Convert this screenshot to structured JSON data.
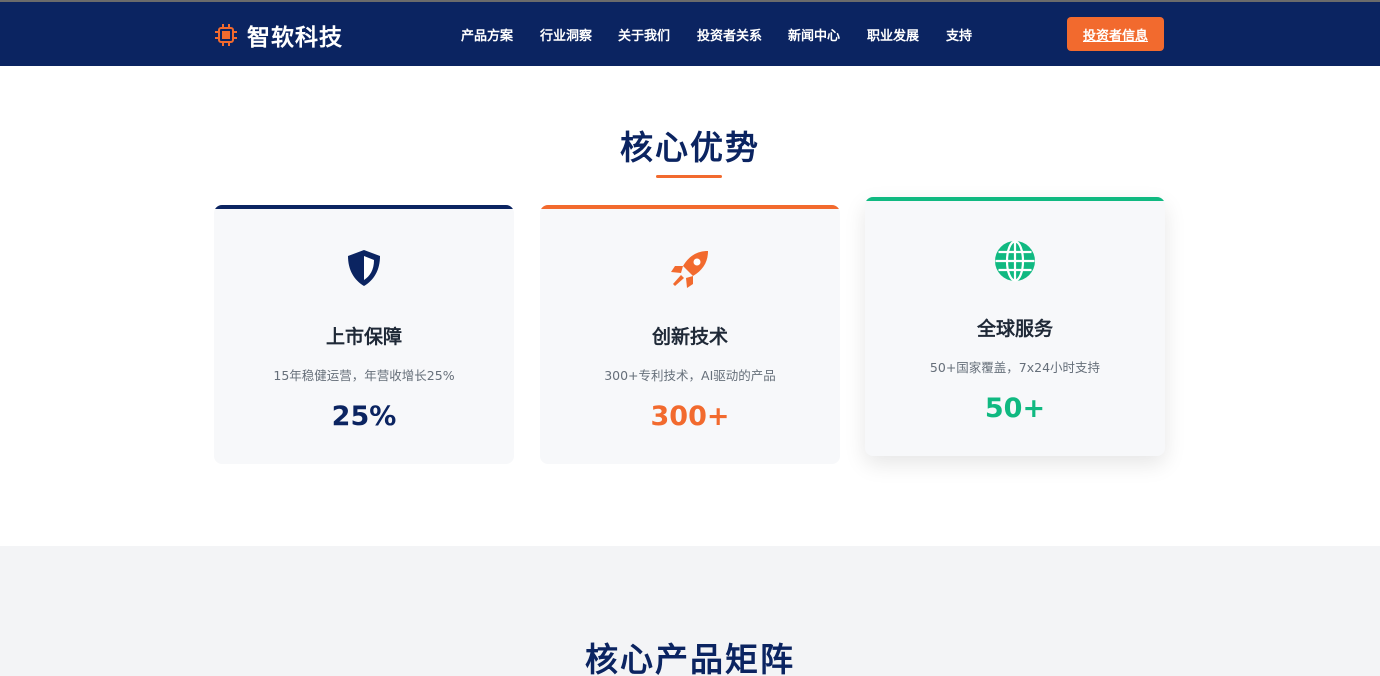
{
  "brand": {
    "name": "智软科技",
    "icon": "chip-icon",
    "accent_color": "#f26a2e",
    "nav_bg_color": "#0b2461"
  },
  "nav": {
    "items": [
      {
        "label": "产品方案"
      },
      {
        "label": "行业洞察"
      },
      {
        "label": "关于我们"
      },
      {
        "label": "投资者关系"
      },
      {
        "label": "新闻中心"
      },
      {
        "label": "职业发展"
      },
      {
        "label": "支持"
      }
    ],
    "cta_label": "投资者信息"
  },
  "advantages": {
    "title": "核心优势",
    "cards": [
      {
        "icon": "shield-icon",
        "title": "上市保障",
        "description": "15年稳健运营，年营收增长25%",
        "value": "25%",
        "color": "#0b2461"
      },
      {
        "icon": "rocket-icon",
        "title": "创新技术",
        "description": "300+专利技术，AI驱动的产品",
        "value": "300+",
        "color": "#f26a2e"
      },
      {
        "icon": "globe-icon",
        "title": "全球服务",
        "description": "50+国家覆盖，7x24小时支持",
        "value": "50+",
        "color": "#10b981"
      }
    ]
  },
  "products": {
    "title": "核心产品矩阵"
  }
}
